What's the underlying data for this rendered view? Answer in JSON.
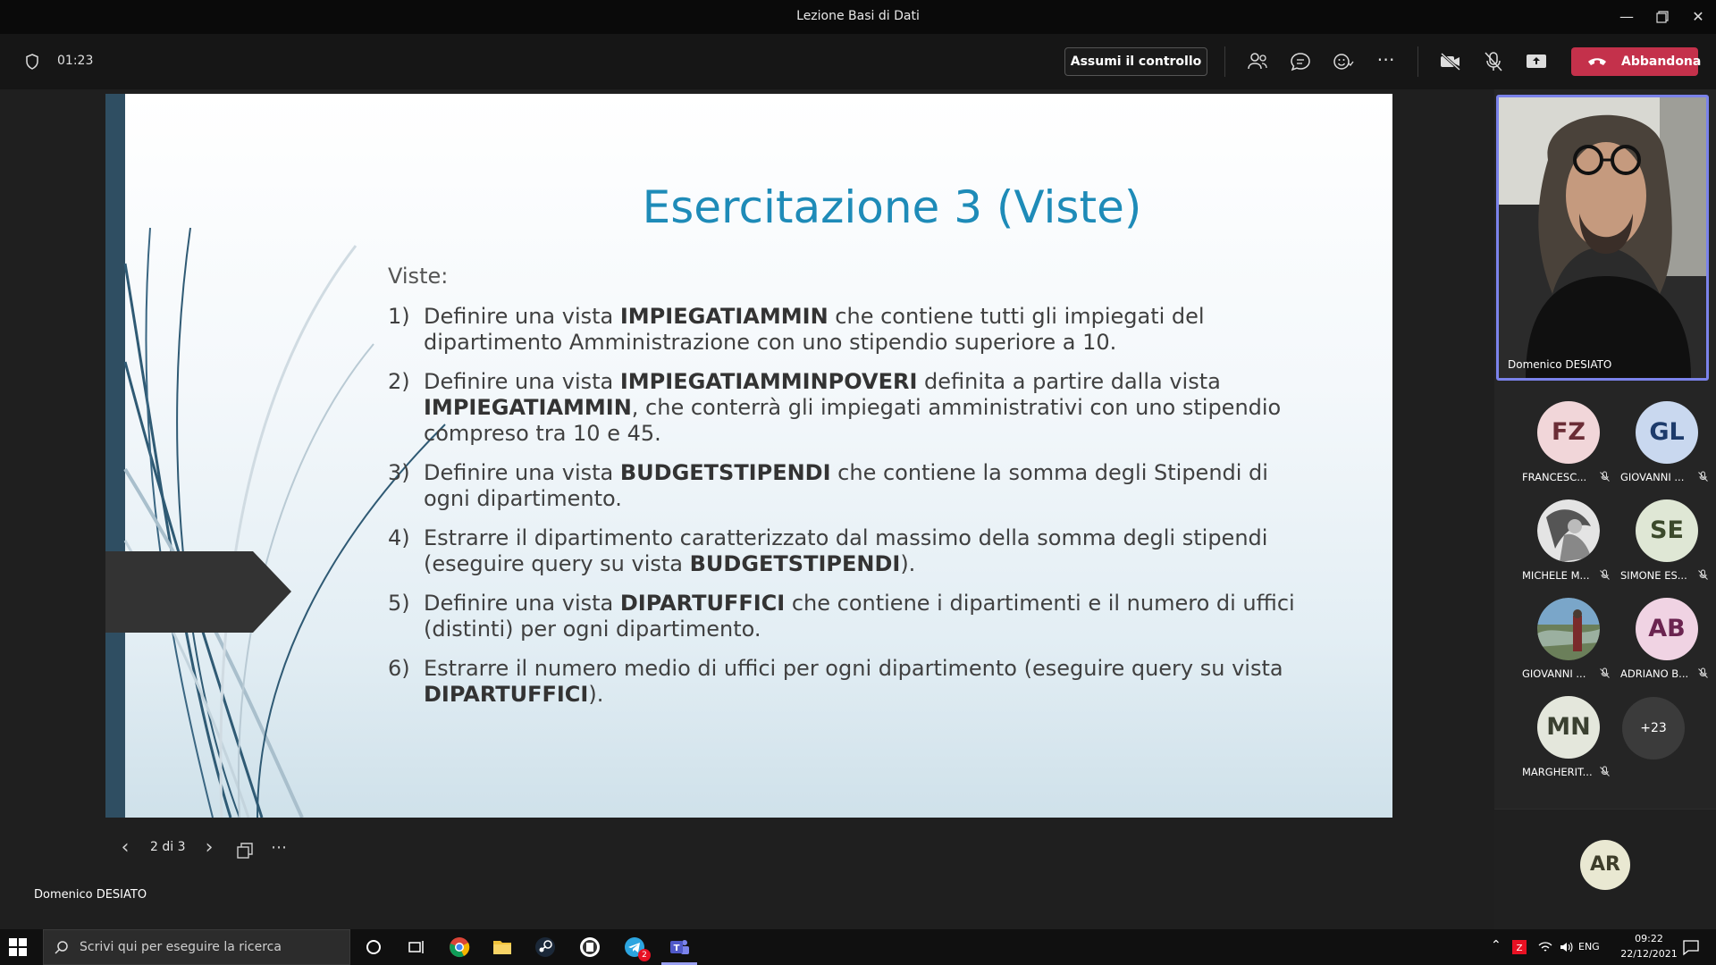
{
  "window": {
    "title": "Lezione Basi di Dati"
  },
  "toolbar": {
    "timer": "01:23",
    "take_control_label": "Assumi il controllo",
    "leave_label": "Abbandona",
    "colors": {
      "leave": "#c4314b",
      "accent": "#7b83eb"
    }
  },
  "slide": {
    "title": "Esercitazione 3 (Viste)",
    "intro": "Viste:",
    "items": [
      {
        "num": "1)",
        "pre": "Definire una vista ",
        "bold": "IMPIEGATIAMMIN",
        "post": " che contiene tutti gli impiegati del dipartimento Amministrazione con uno stipendio superiore a 10."
      },
      {
        "num": "2)",
        "pre": "Definire una vista ",
        "bold": "IMPIEGATIAMMINPOVERI",
        "mid": " definita a partire dalla vista ",
        "bold2": "IMPIEGATIAMMIN",
        "post": ", che conterrà gli impiegati amministrativi con uno stipendio compreso tra 10 e 45."
      },
      {
        "num": "3)",
        "pre": "Definire una vista ",
        "bold": "BUDGETSTIPENDI",
        "post": " che contiene la somma degli Stipendi di ogni dipartimento."
      },
      {
        "num": "4)",
        "pre": "Estrarre il dipartimento caratterizzato dal massimo della somma degli stipendi (eseguire query su vista ",
        "bold": "BUDGETSTIPENDI",
        "post": ")."
      },
      {
        "num": "5)",
        "pre": "Definire una vista ",
        "bold": "DIPARTUFFICI",
        "post": " che contiene i dipartimenti e il numero di uffici (distinti) per ogni dipartimento."
      },
      {
        "num": "6)",
        "pre": "Estrarre il numero medio di uffici per ogni dipartimento (eseguire query su vista ",
        "bold": "DIPARTUFFICI",
        "post": ")."
      }
    ]
  },
  "slide_nav": {
    "page_count": "2 di 3"
  },
  "presenter": {
    "name": "Domenico DESIATO"
  },
  "participants": [
    {
      "initials": "FZ",
      "name": "FRANCESC...",
      "bg": "#f1d6d9",
      "fg": "#6b2d36"
    },
    {
      "initials": "GL",
      "name": "GIOVANNI ...",
      "bg": "#c9d8ef",
      "fg": "#1d3b6b"
    },
    {
      "initials": "",
      "name": "MICHELE M...",
      "bg": "#d9d9d9",
      "fg": "#333333",
      "photo": "sketch"
    },
    {
      "initials": "SE",
      "name": "SIMONE ES...",
      "bg": "#dfe7d5",
      "fg": "#3c4a2c"
    },
    {
      "initials": "",
      "name": "GIOVANNI ...",
      "bg": "#7aa6c9",
      "fg": "#333333",
      "photo": "landscape"
    },
    {
      "initials": "AB",
      "name": "ADRIANO B...",
      "bg": "#f0d3e3",
      "fg": "#6b2450"
    },
    {
      "initials": "MN",
      "name": "MARGHERIT...",
      "bg": "#e4e7dc",
      "fg": "#3a4030"
    }
  ],
  "more_participants": "+23",
  "self": {
    "initials": "AR"
  },
  "taskbar": {
    "search_placeholder": "Scrivi qui per eseguire la ricerca",
    "language": "ENG",
    "time": "09:22",
    "date": "22/12/2021",
    "telegram_badge": "2"
  }
}
